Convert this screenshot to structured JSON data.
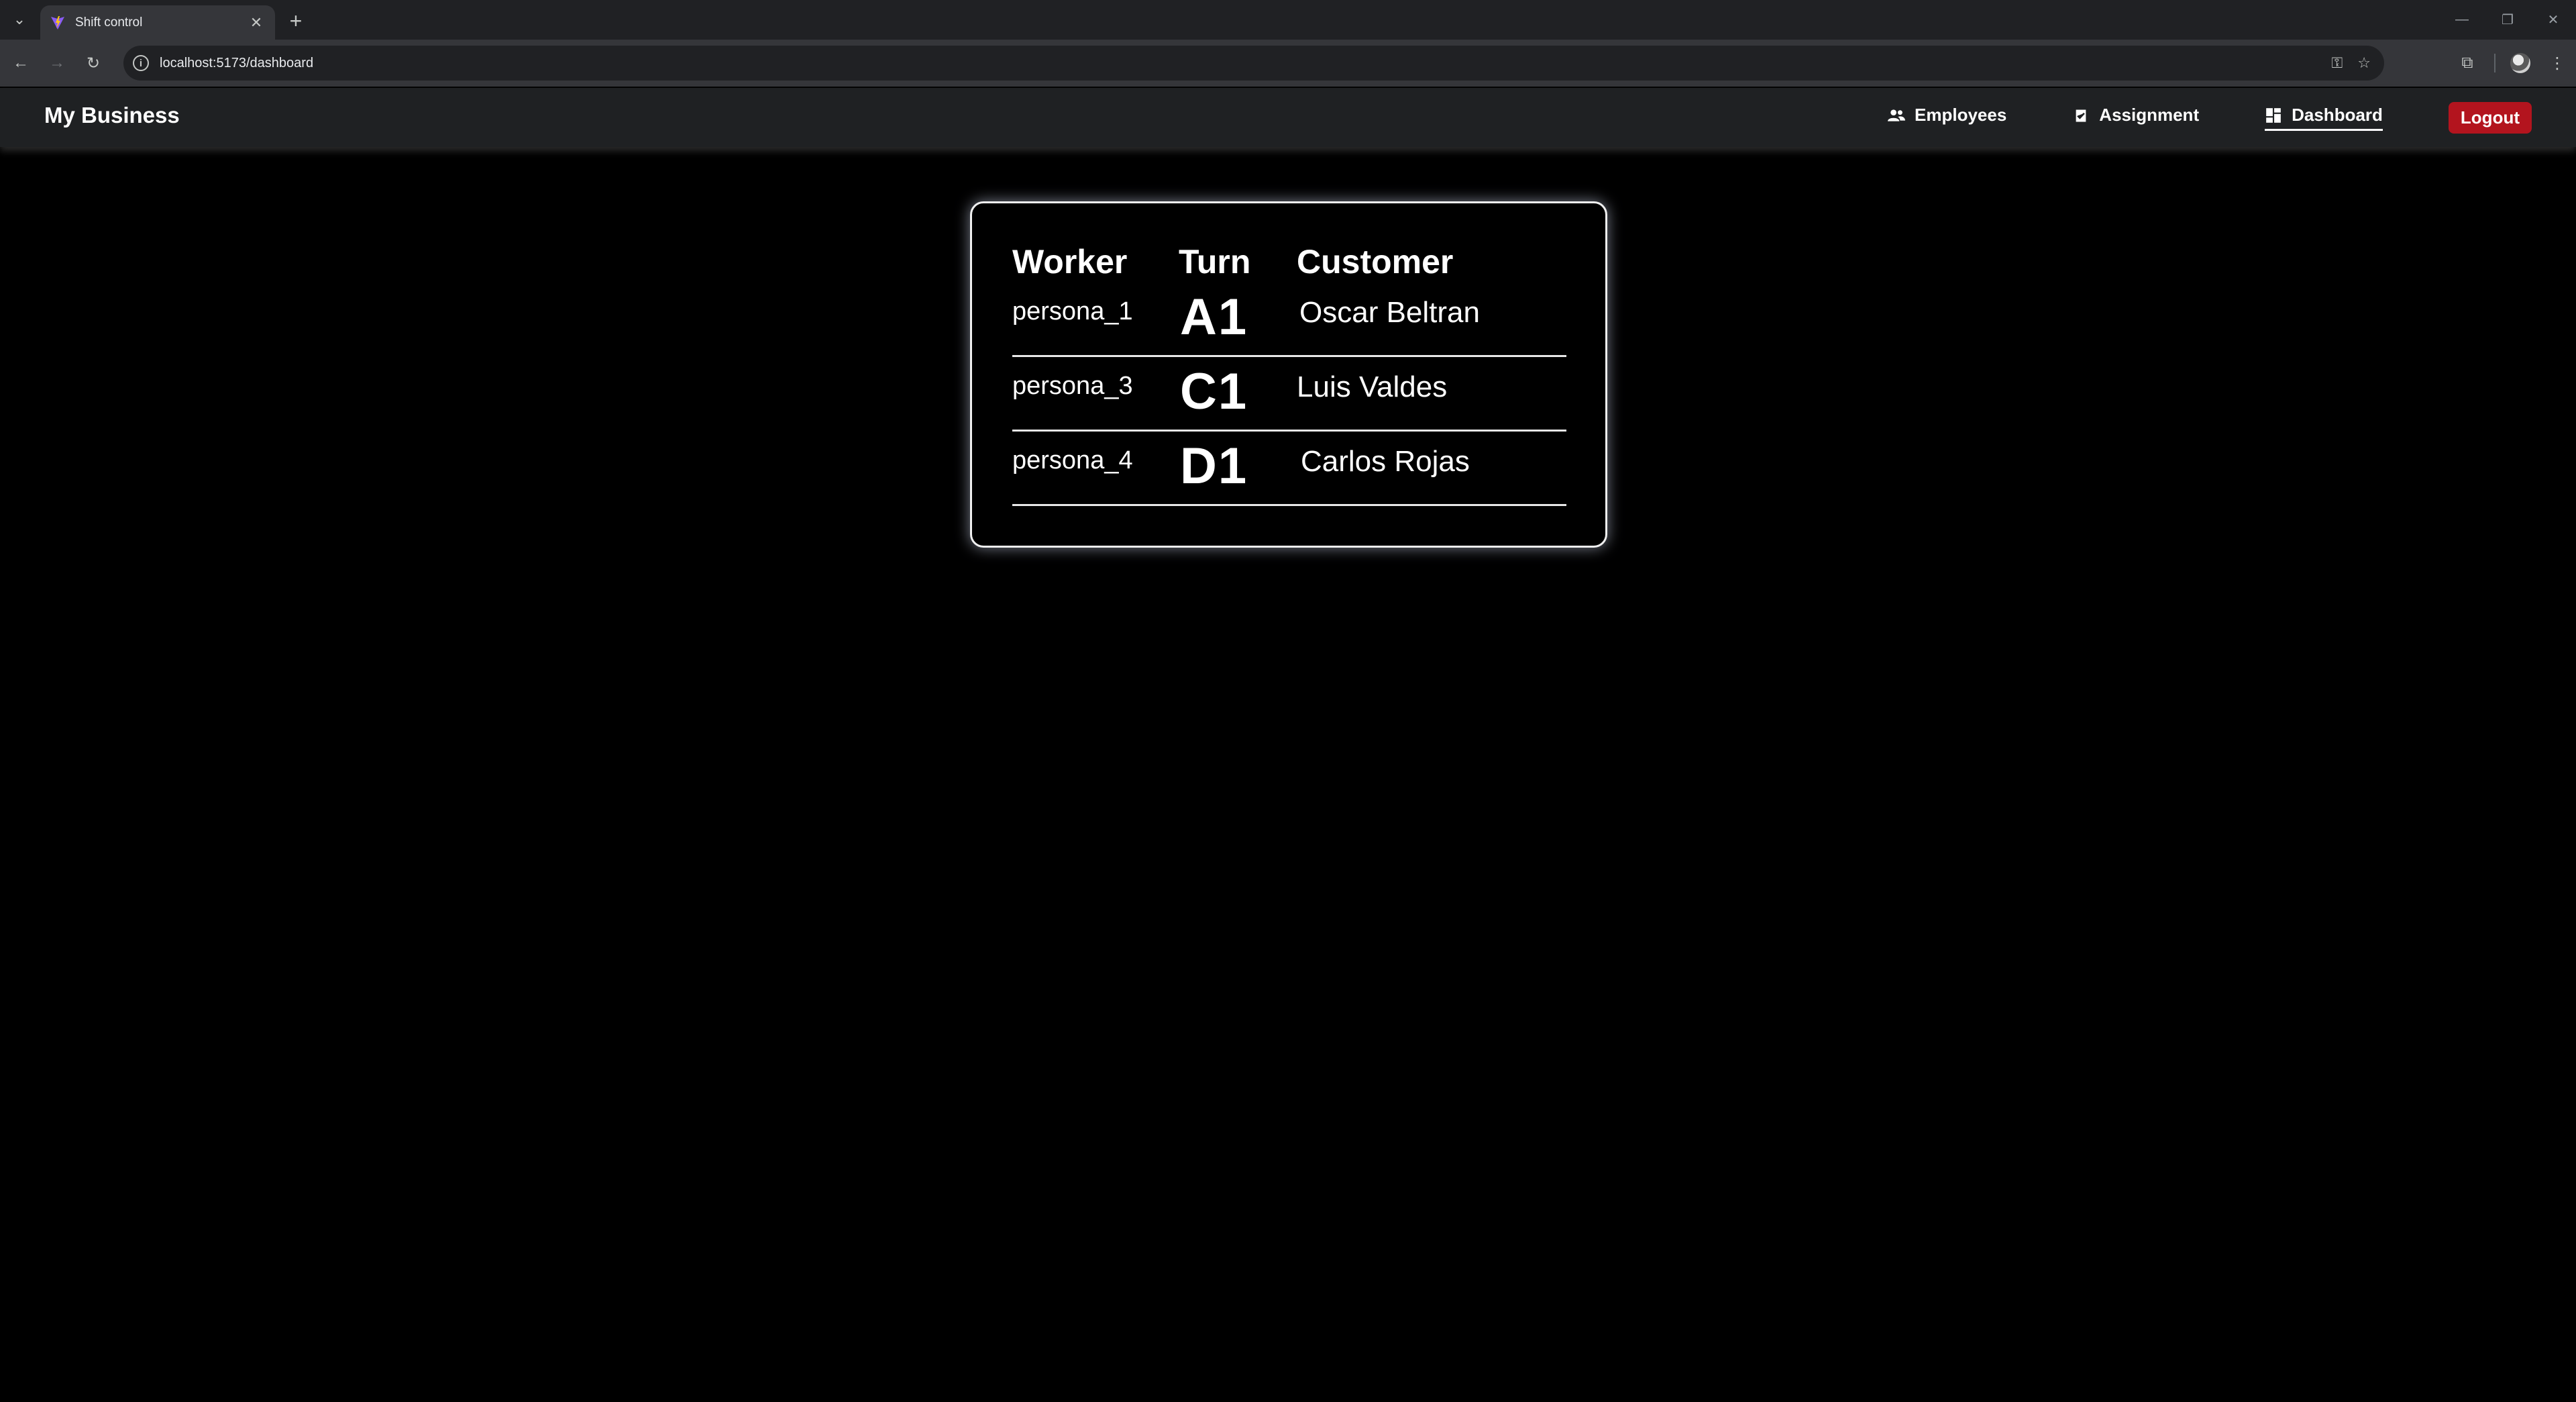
{
  "browser": {
    "tab_title": "Shift control",
    "url": "localhost:5173/dashboard"
  },
  "app": {
    "brand": "My Business",
    "nav": {
      "employees": "Employees",
      "assignment": "Assignment",
      "dashboard": "Dashboard",
      "logout": "Logout"
    }
  },
  "dashboard": {
    "headers": {
      "worker": "Worker",
      "turn": "Turn",
      "customer": "Customer"
    },
    "rows": [
      {
        "worker": "persona_1",
        "turn": "A1",
        "customer": "Oscar Beltran"
      },
      {
        "worker": "persona_3",
        "turn": "C1",
        "customer": "Luis Valdes"
      },
      {
        "worker": "persona_4",
        "turn": "D1",
        "customer": "Carlos Rojas"
      }
    ]
  },
  "colors": {
    "logout_bg": "#b3141e",
    "nav_bg": "#1f2123",
    "page_bg": "#000000"
  }
}
